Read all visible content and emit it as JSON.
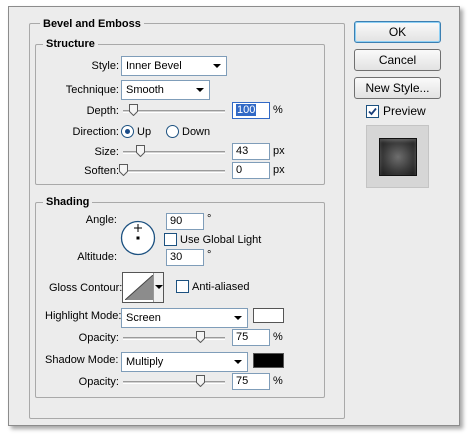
{
  "section_title": "Bevel and Emboss",
  "structure": {
    "title": "Structure",
    "style_label": "Style:",
    "style_value": "Inner Bevel",
    "technique_label": "Technique:",
    "technique_value": "Smooth",
    "depth_label": "Depth:",
    "depth_value": "100",
    "depth_unit": "%",
    "depth_level": 0.1,
    "direction_label": "Direction:",
    "direction_up": "Up",
    "direction_down": "Down",
    "direction_selected": "Up",
    "size_label": "Size:",
    "size_value": "43",
    "size_unit": "px",
    "size_level": 0.17,
    "soften_label": "Soften:",
    "soften_value": "0",
    "soften_unit": "px",
    "soften_level": 0.0
  },
  "shading": {
    "title": "Shading",
    "angle_label": "Angle:",
    "angle_value": "90",
    "angle_unit": "°",
    "use_global_light_label": "Use Global Light",
    "use_global_light_checked": false,
    "altitude_label": "Altitude:",
    "altitude_value": "30",
    "altitude_unit": "°",
    "gloss_contour_label": "Gloss Contour:",
    "anti_aliased_label": "Anti-aliased",
    "anti_aliased_checked": false,
    "highlight_mode_label": "Highlight Mode:",
    "highlight_mode_value": "Screen",
    "highlight_color": "#ffffff",
    "highlight_opacity_label": "Opacity:",
    "highlight_opacity_value": "75",
    "highlight_opacity_unit": "%",
    "highlight_opacity_level": 0.75,
    "shadow_mode_label": "Shadow Mode:",
    "shadow_mode_value": "Multiply",
    "shadow_color": "#000000",
    "shadow_opacity_label": "Opacity:",
    "shadow_opacity_value": "75",
    "shadow_opacity_unit": "%",
    "shadow_opacity_level": 0.75
  },
  "buttons": {
    "ok": "OK",
    "cancel": "Cancel",
    "new_style": "New Style..."
  },
  "preview": {
    "label": "Preview",
    "checked": true
  }
}
